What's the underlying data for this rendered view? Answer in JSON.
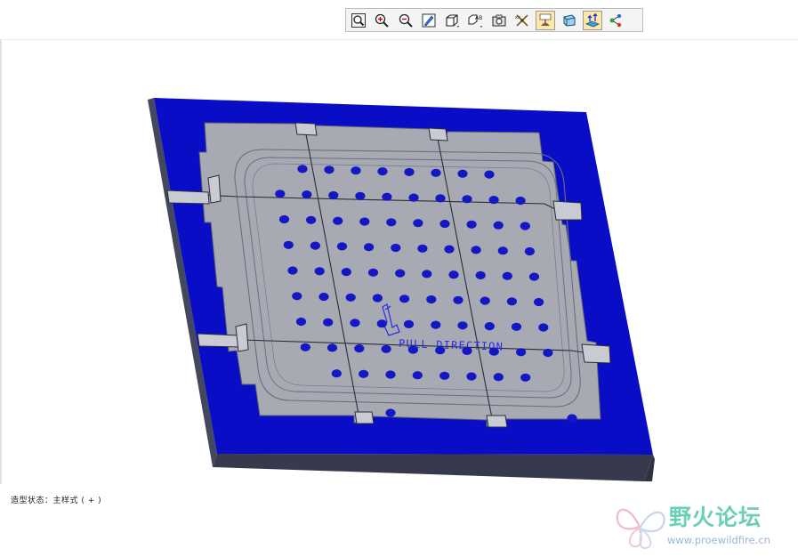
{
  "toolbar": {
    "buttons": [
      {
        "name": "zoom-fit-button",
        "icon": "zoom-fit-icon"
      },
      {
        "name": "zoom-in-button",
        "icon": "zoom-in-icon"
      },
      {
        "name": "zoom-out-button",
        "icon": "zoom-out-icon"
      },
      {
        "name": "repaint-button",
        "icon": "repaint-icon"
      },
      {
        "name": "display-style-button",
        "icon": "cube-icon"
      },
      {
        "name": "saved-views-button",
        "icon": "saved-views-icon"
      },
      {
        "name": "layers-button",
        "icon": "camera-icon"
      },
      {
        "name": "datum-display-button",
        "icon": "datum-icon"
      },
      {
        "name": "annotation-display-button",
        "icon": "annotation-icon"
      },
      {
        "name": "spin-center-button",
        "icon": "spin-center-icon"
      },
      {
        "name": "pull-direction-button",
        "icon": "pull-direction-icon"
      },
      {
        "name": "model-tree-button",
        "icon": "tree-icon"
      }
    ],
    "active": [
      8,
      10
    ]
  },
  "viewport": {
    "annotation": "PULL DIRECTION",
    "colors": {
      "plate_top": "#0a0dc6",
      "plate_side": "#3c4052",
      "insert": "#a9abb3",
      "holes": "#1418c4",
      "annotation": "#2b2be0"
    }
  },
  "status": {
    "text": "造型状态：主样式 ( + )"
  },
  "watermark": {
    "title": "野火论坛",
    "url": "www.proewildfire.cn"
  }
}
